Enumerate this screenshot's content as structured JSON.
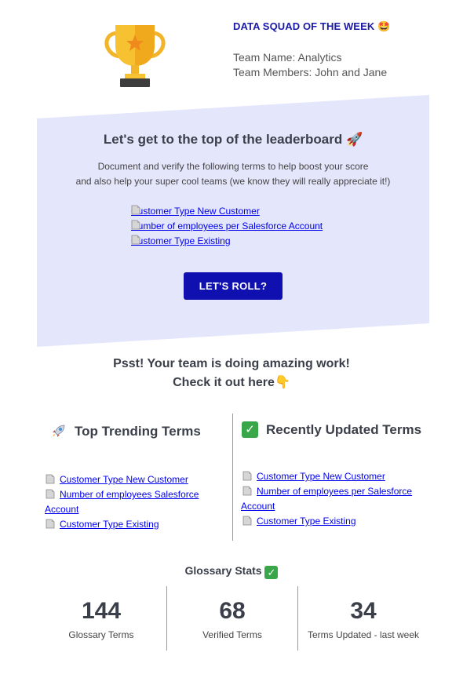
{
  "header": {
    "title": "DATA SQUAD OF THE WEEK",
    "title_emoji": "🤩",
    "team_name": "Team Name: Analytics",
    "team_members": "Team Members: John and Jane",
    "trophy_icon": "trophy-icon"
  },
  "banner": {
    "title": "Let's get to the top of the leaderboard 🚀",
    "text_line1": "Document and verify the following terms to help boost your score",
    "text_line2": "and also help your super cool teams (we know they will really appreciate it!)",
    "links": [
      "Customer Type New Customer",
      "Number of employees per Salesforce Account",
      "Customer Type Existing"
    ],
    "button_label": "LET'S ROLL?",
    "background_color": "#e4e6fb",
    "button_color": "#1010b0"
  },
  "psst": {
    "line1": "Psst! Your team is doing amazing work!",
    "line2": "Check it out here",
    "line2_emoji": "👇"
  },
  "trending": {
    "heading": "Top Trending Terms",
    "icon": "rocket-icon",
    "links": [
      "Customer Type New Customer",
      "Number of employees Salesforce",
      "Account",
      "Customer Type Existing"
    ]
  },
  "updated": {
    "heading": "Recently Updated Terms",
    "icon": "check-icon",
    "links": [
      "Customer Type New Customer",
      "Number of employees per Salesforce",
      "Account",
      "Customer Type Existing"
    ]
  },
  "stats": {
    "title": "Glossary Stats",
    "items": [
      {
        "value": "144",
        "label": "Glossary Terms"
      },
      {
        "value": "68",
        "label": "Verified Terms"
      },
      {
        "value": "34",
        "label": "Terms Updated - last week"
      }
    ]
  }
}
